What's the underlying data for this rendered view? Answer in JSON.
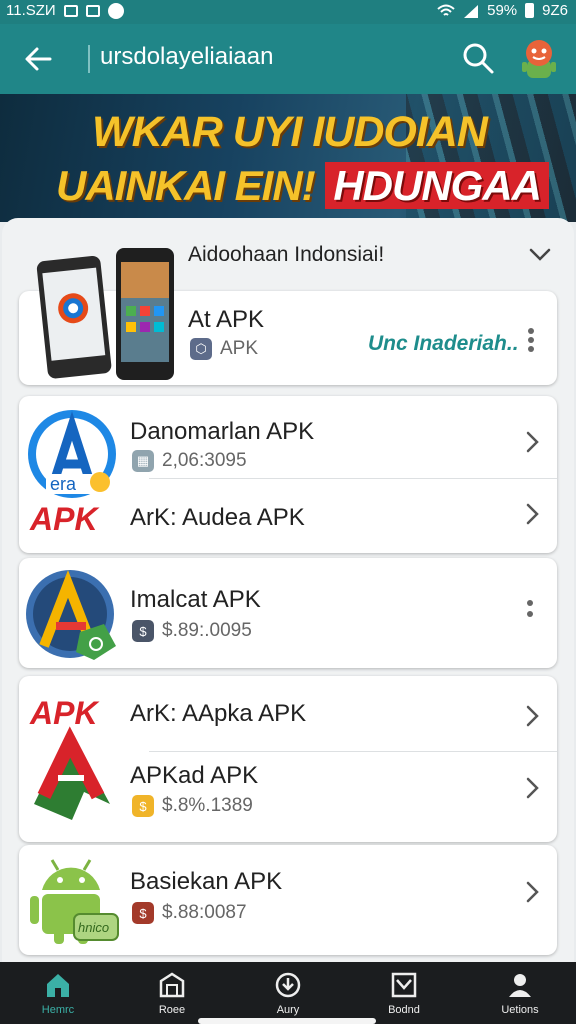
{
  "status_bar": {
    "time": "11.SZИ",
    "battery": "59%",
    "clock": "9Z6"
  },
  "app_bar": {
    "title": "ursdolayeliaiaan",
    "back_icon": "arrow-left-icon",
    "search_icon": "search-icon"
  },
  "banner": {
    "line1": "WKAR UYI IUDOIAN",
    "line2_a": "UAINKAI EIN!",
    "line2_b": "HDUNGAA"
  },
  "panel": {
    "header": "Aidoohaan Indonsiai!"
  },
  "featured": {
    "title": "At APK",
    "subtitle": "APK",
    "action": "Unc Inaderiah.."
  },
  "list_a": [
    {
      "title": "Danomarlan APK",
      "meta": "2,06:3095",
      "logo_text": "APK",
      "logo_sub": "era"
    },
    {
      "title": "ArK: Audea APK"
    }
  ],
  "list_b": {
    "title": "Imalcat APK",
    "meta": "$.89:.0095"
  },
  "list_c": [
    {
      "title": "ArK: AApka APK",
      "logo_text": "APK"
    },
    {
      "title": "APKad APK",
      "meta": "$.8%.1389"
    },
    {
      "title": "Basiekan APK",
      "meta": "$.88:0087",
      "logo_text": "hnico"
    }
  ],
  "nav": [
    {
      "label": "Hemrc",
      "icon": "home-icon"
    },
    {
      "label": "Roee",
      "icon": "store-icon"
    },
    {
      "label": "Aury",
      "icon": "download-icon"
    },
    {
      "label": "Bodnd",
      "icon": "checkbox-icon"
    },
    {
      "label": "Uetions",
      "icon": "user-icon"
    }
  ],
  "colors": {
    "accent": "#208688",
    "link": "#1e8d8c",
    "nav_bg": "#1b1d1f",
    "banner_text": "#f5c22a",
    "apk_red": "#d8232a"
  }
}
